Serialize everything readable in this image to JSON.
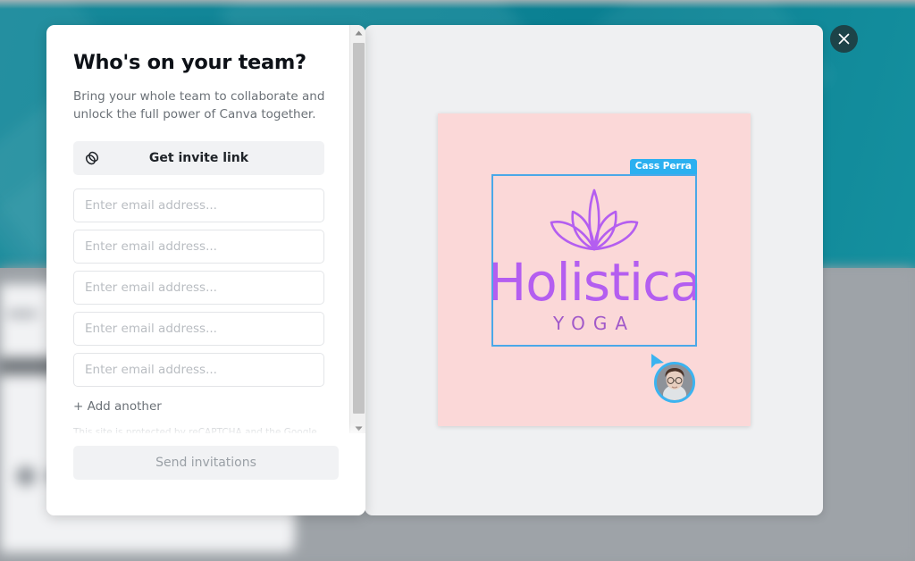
{
  "modal": {
    "title": "Who's on your team?",
    "subtitle": "Bring your whole team to collaborate and unlock the full power of Canva together.",
    "invite_link_label": "Get invite link",
    "link_icon": "chain-link-icon",
    "email_placeholder": "Enter email address...",
    "email_values": [
      "",
      "",
      "",
      "",
      ""
    ],
    "email_field_count": 5,
    "add_another_label": "+ Add another",
    "recaptcha_note": "This site is protected by reCAPTCHA and the Google Privacy",
    "send_label": "Send invitations",
    "send_disabled": true
  },
  "scrollbar": {
    "up_icon": "triangle-up-icon",
    "down_icon": "triangle-down-icon"
  },
  "close_button": {
    "icon": "close-icon",
    "label": "Close"
  },
  "design": {
    "canvas_background": "#fbd8d8",
    "logo_icon": "lotus-flower-icon",
    "brand_name": "Holistica",
    "brand_subtitle": "YOGA",
    "brand_color": "#b45ef0",
    "subtitle_color": "#a159c9",
    "selection_color": "#4aa8e8",
    "collaborator": {
      "name": "Cass Perra",
      "tag_color": "#2bb0f0",
      "cursor_icon": "collaborator-cursor-icon",
      "avatar_icon": "user-avatar"
    }
  },
  "theme": {
    "teal": "#0e8496",
    "backdrop_gray": "#9a9fa4",
    "panel_gray": "#eff0f2"
  }
}
